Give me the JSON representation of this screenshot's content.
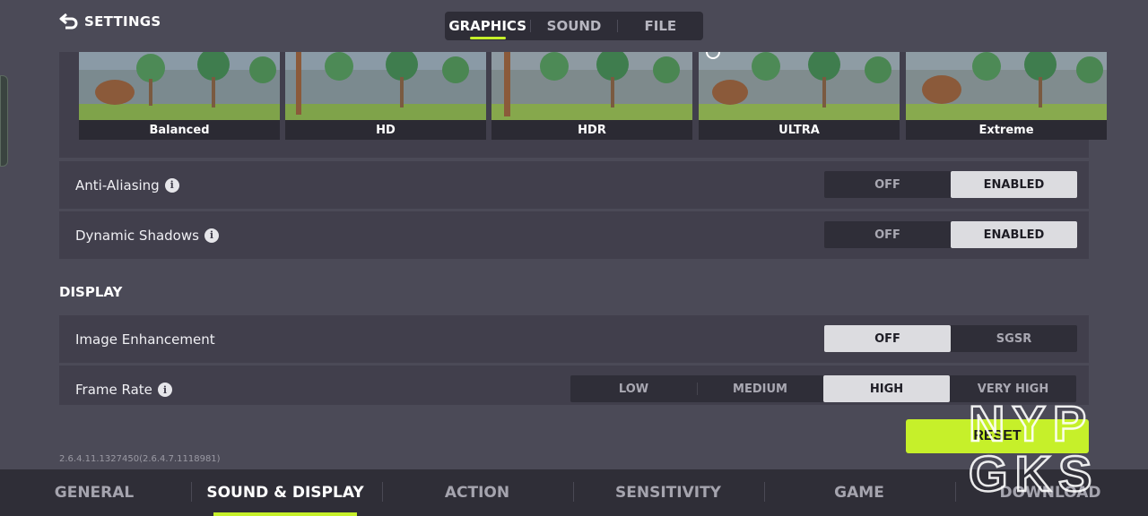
{
  "header": {
    "title": "SETTINGS",
    "tabs": [
      {
        "label": "GRAPHICS",
        "active": true
      },
      {
        "label": "SOUND",
        "active": false
      },
      {
        "label": "FILE",
        "active": false
      }
    ]
  },
  "graphics_presets": [
    {
      "label": "Balanced",
      "selected": false
    },
    {
      "label": "HD",
      "selected": false
    },
    {
      "label": "HDR",
      "selected": false
    },
    {
      "label": "ULTRA",
      "selected": true
    },
    {
      "label": "Extreme",
      "selected": false
    }
  ],
  "settings": {
    "anti_aliasing": {
      "label": "Anti-Aliasing",
      "options": [
        "OFF",
        "ENABLED"
      ],
      "selected": "ENABLED"
    },
    "dynamic_shadows": {
      "label": "Dynamic Shadows",
      "options": [
        "OFF",
        "ENABLED"
      ],
      "selected": "ENABLED"
    }
  },
  "display": {
    "section_title": "DISPLAY",
    "image_enhancement": {
      "label": "Image Enhancement",
      "options": [
        "OFF",
        "SGSR"
      ],
      "selected": "OFF"
    },
    "frame_rate": {
      "label": "Frame Rate",
      "options": [
        "LOW",
        "MEDIUM",
        "HIGH",
        "VERY HIGH"
      ],
      "selected": "HIGH"
    }
  },
  "reset_label": "RESET",
  "version": "2.6.4.11.1327450(2.6.4.7.1118981)",
  "bottom_nav": [
    {
      "label": "GENERAL",
      "active": false
    },
    {
      "label": "SOUND & DISPLAY",
      "active": true
    },
    {
      "label": "ACTION",
      "active": false
    },
    {
      "label": "SENSITIVITY",
      "active": false
    },
    {
      "label": "GAME",
      "active": false
    },
    {
      "label": "DOWNLOAD",
      "active": false
    }
  ],
  "watermark": {
    "line1": "NYP",
    "line2": "GKS"
  },
  "colors": {
    "accent": "#c6f02a",
    "background": "#4b4a57",
    "panel": "#413f4c"
  }
}
